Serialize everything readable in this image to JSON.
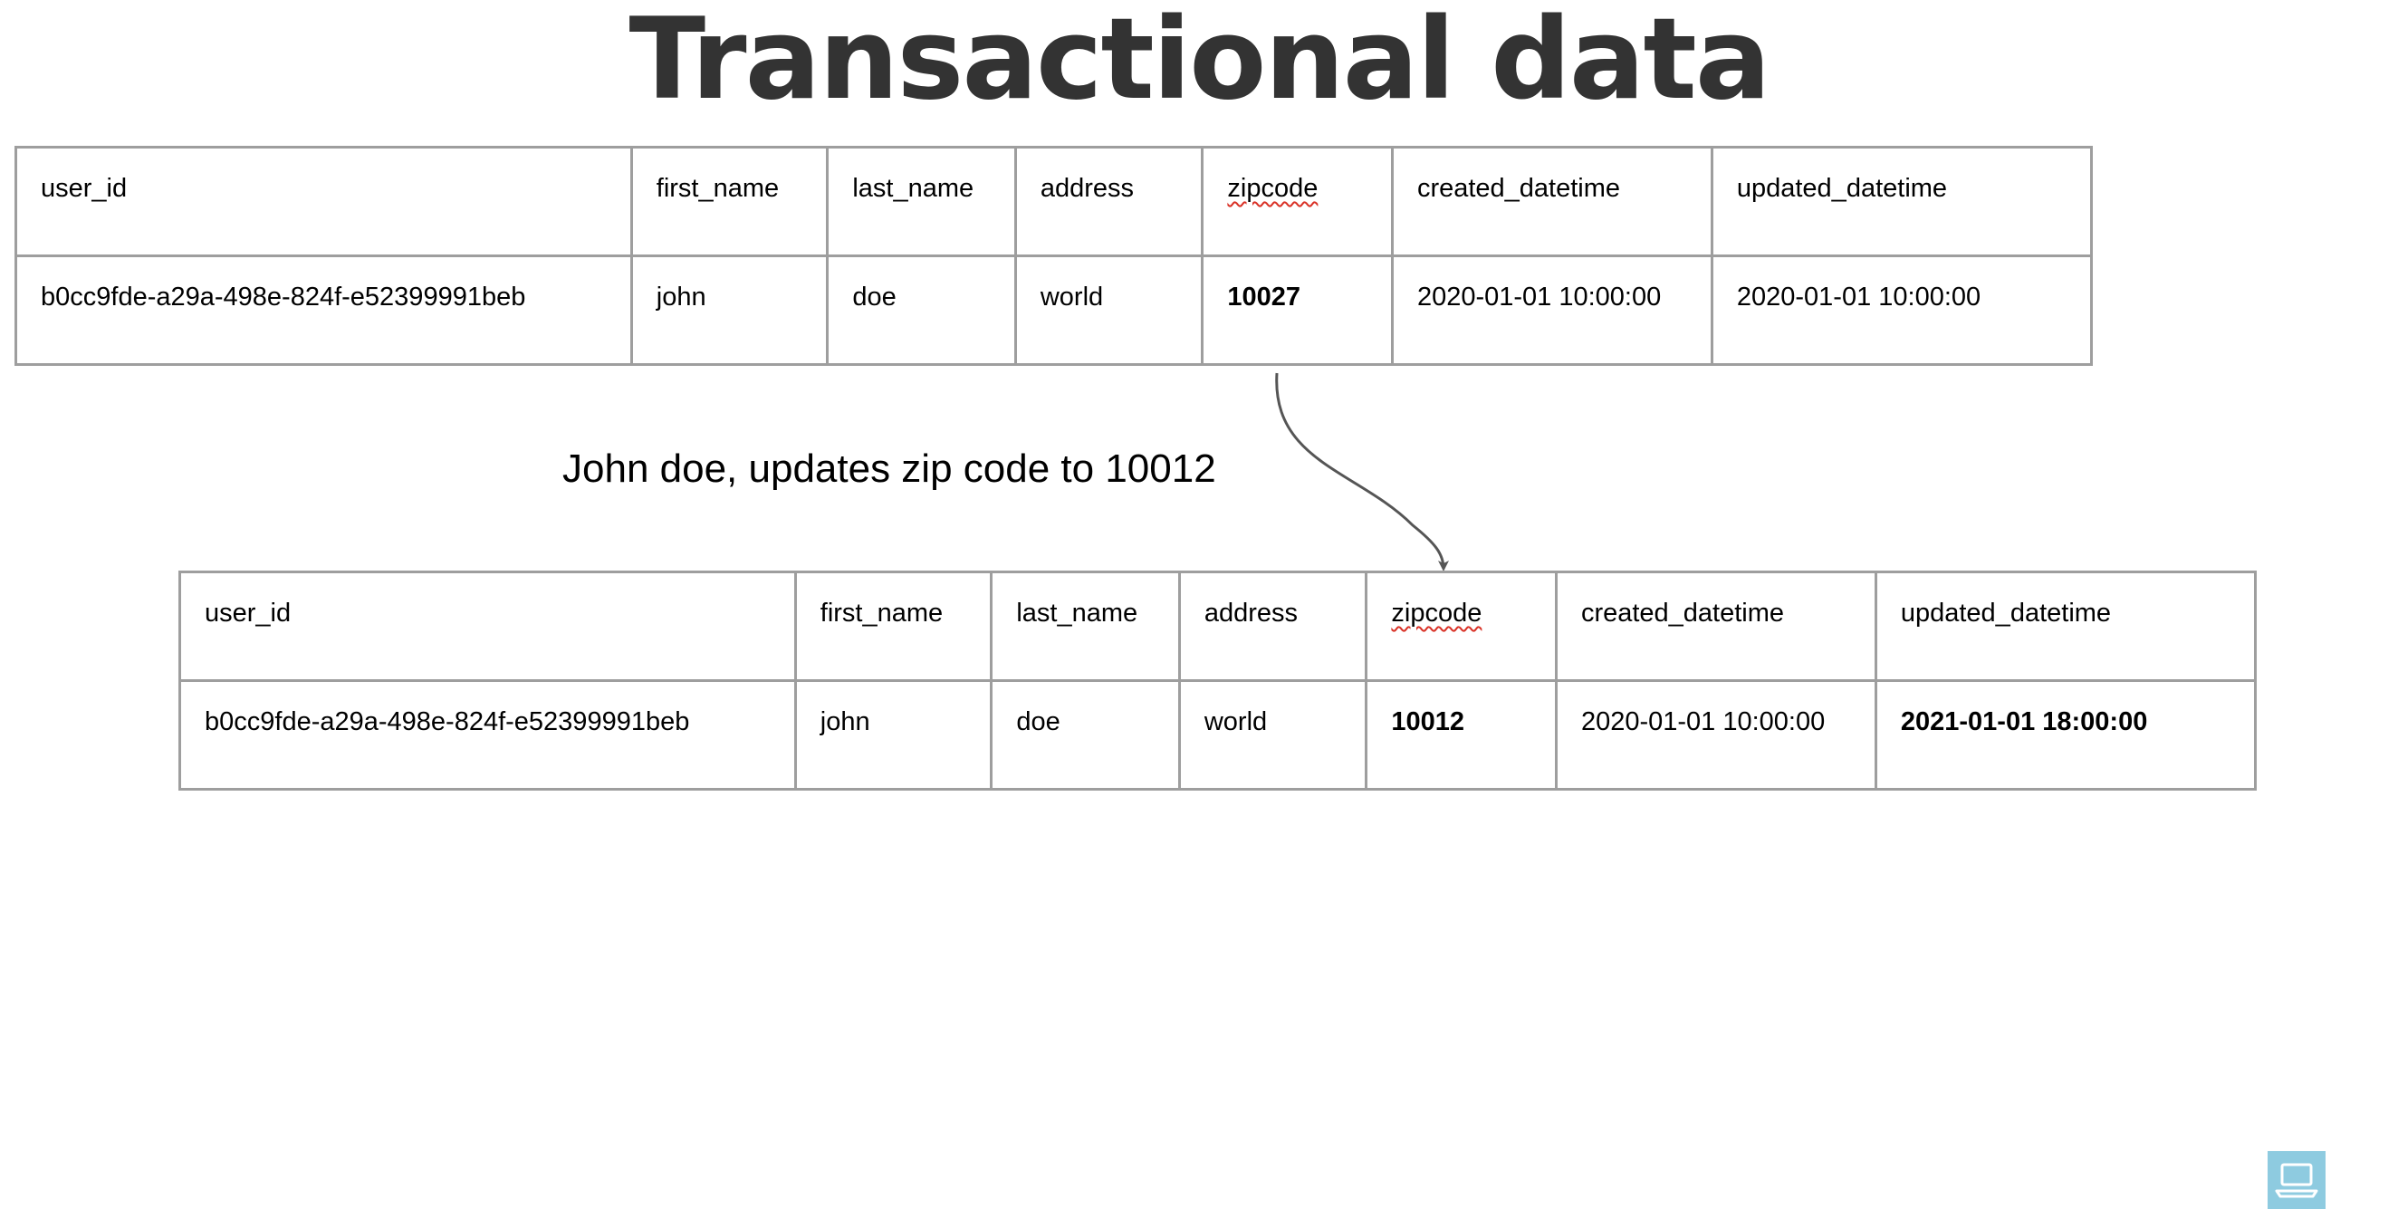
{
  "title": "Transactional data",
  "columns": [
    "user_id",
    "first_name",
    "last_name",
    "address",
    "zipcode",
    "created_datetime",
    "updated_datetime"
  ],
  "before": {
    "row": [
      "b0cc9fde-a29a-498e-824f-e52399991beb",
      "john",
      "doe",
      "world",
      "10027",
      "2020-01-01 10:00:00",
      "2020-01-01 10:00:00"
    ]
  },
  "annotation": "John doe, updates zip code to 10012",
  "after": {
    "row": [
      "b0cc9fde-a29a-498e-824f-e52399991beb",
      "john",
      "doe",
      "world",
      "10012",
      "2020-01-01 10:00:00",
      "2021-01-01 18:00:00"
    ]
  },
  "icons": {
    "corner": "laptop-icon"
  },
  "colors": {
    "title": "#333333",
    "border": "#9e9e9e",
    "arrow": "#555555",
    "icon_bg": "#8ecbe0"
  }
}
